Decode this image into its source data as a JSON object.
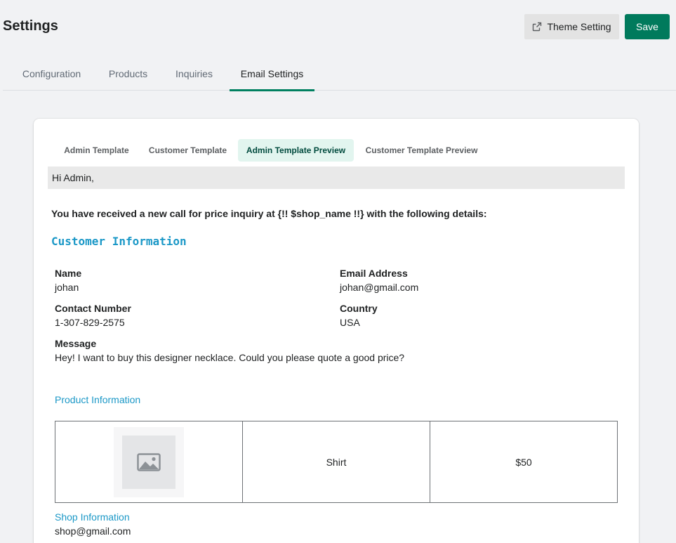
{
  "page": {
    "title": "Settings",
    "theme_setting_label": "Theme Setting",
    "save_label": "Save"
  },
  "tabs": [
    {
      "label": "Configuration",
      "active": false
    },
    {
      "label": "Products",
      "active": false
    },
    {
      "label": "Inquiries",
      "active": false
    },
    {
      "label": "Email Settings",
      "active": true
    }
  ],
  "subtabs": [
    {
      "label": "Admin Template",
      "active": false
    },
    {
      "label": "Customer Template",
      "active": false
    },
    {
      "label": "Admin Template Preview",
      "active": true
    },
    {
      "label": "Customer Template Preview",
      "active": false
    }
  ],
  "email": {
    "greeting": "Hi Admin,",
    "intro": "You have received a new call for price inquiry at {!! $shop_name !!} with the following details:",
    "customer_heading": "Customer Information",
    "fields": {
      "name": {
        "label": "Name",
        "value": "johan"
      },
      "email": {
        "label": "Email Address",
        "value": "johan@gmail.com"
      },
      "contact": {
        "label": "Contact Number",
        "value": "1-307-829-2575"
      },
      "country": {
        "label": "Country",
        "value": "USA"
      },
      "message": {
        "label": "Message",
        "value": "Hey! I want to buy this designer necklace. Could you please quote a good price?"
      }
    },
    "product_heading": "Product Information",
    "product": {
      "image_icon": "image-placeholder-icon",
      "name": "Shirt",
      "price": "$50"
    },
    "shop_heading": "Shop Information",
    "shop_email": "shop@gmail.com"
  },
  "colors": {
    "primary": "#007a5c",
    "accent_link": "#1b98c7",
    "active_subtab_bg": "#e2f5ef",
    "background": "#f1f2f4"
  }
}
